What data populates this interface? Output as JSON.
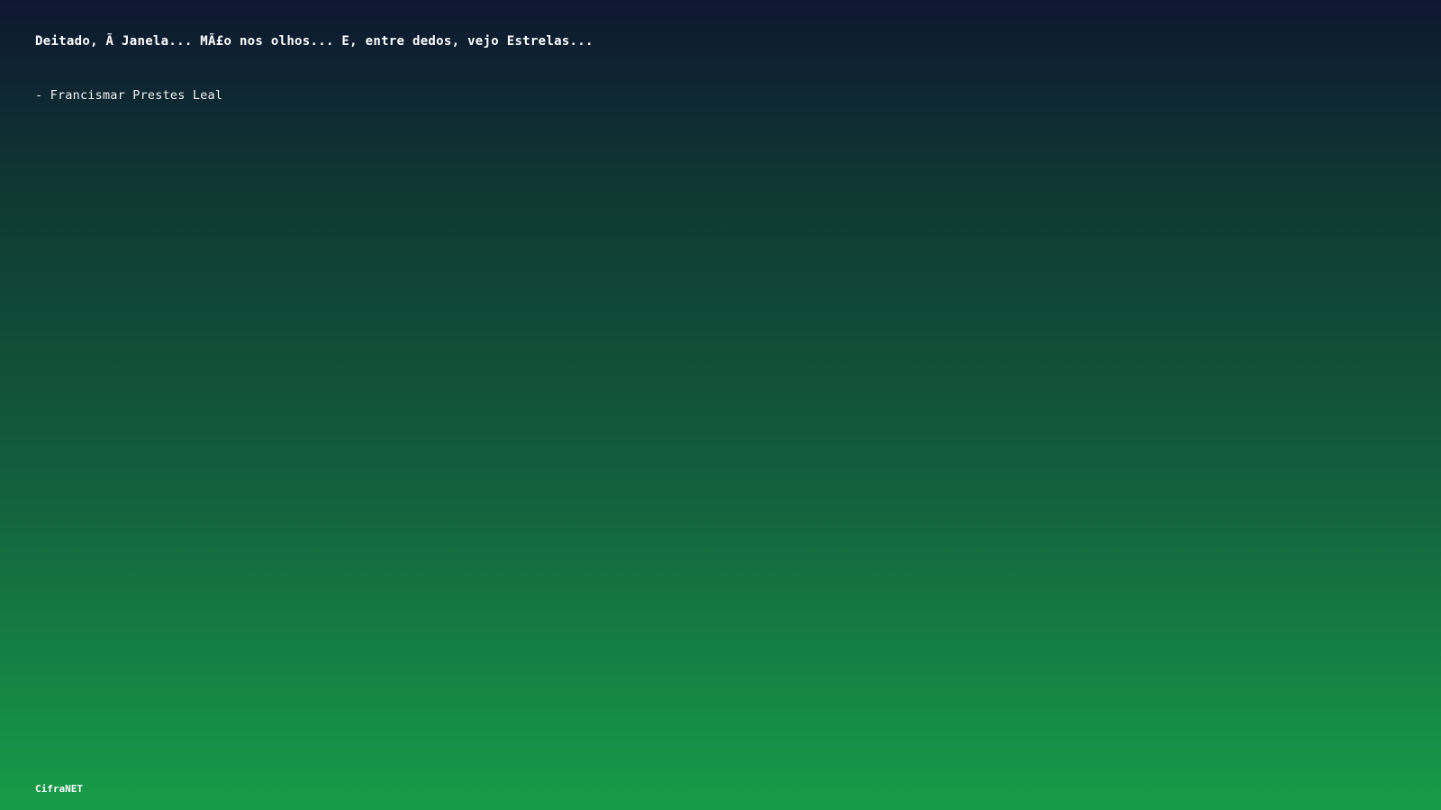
{
  "quote": {
    "text": "Deitado, Ã  Janela... MÃ£o nos olhos... E, entre dedos, vejo Estrelas...",
    "author": "- Francismar Prestes Leal"
  },
  "footer": {
    "brand": "CifraNET"
  },
  "colors": {
    "gradient_top": "#0e1730",
    "gradient_bottom": "#169c48",
    "text": "#ffffff"
  }
}
